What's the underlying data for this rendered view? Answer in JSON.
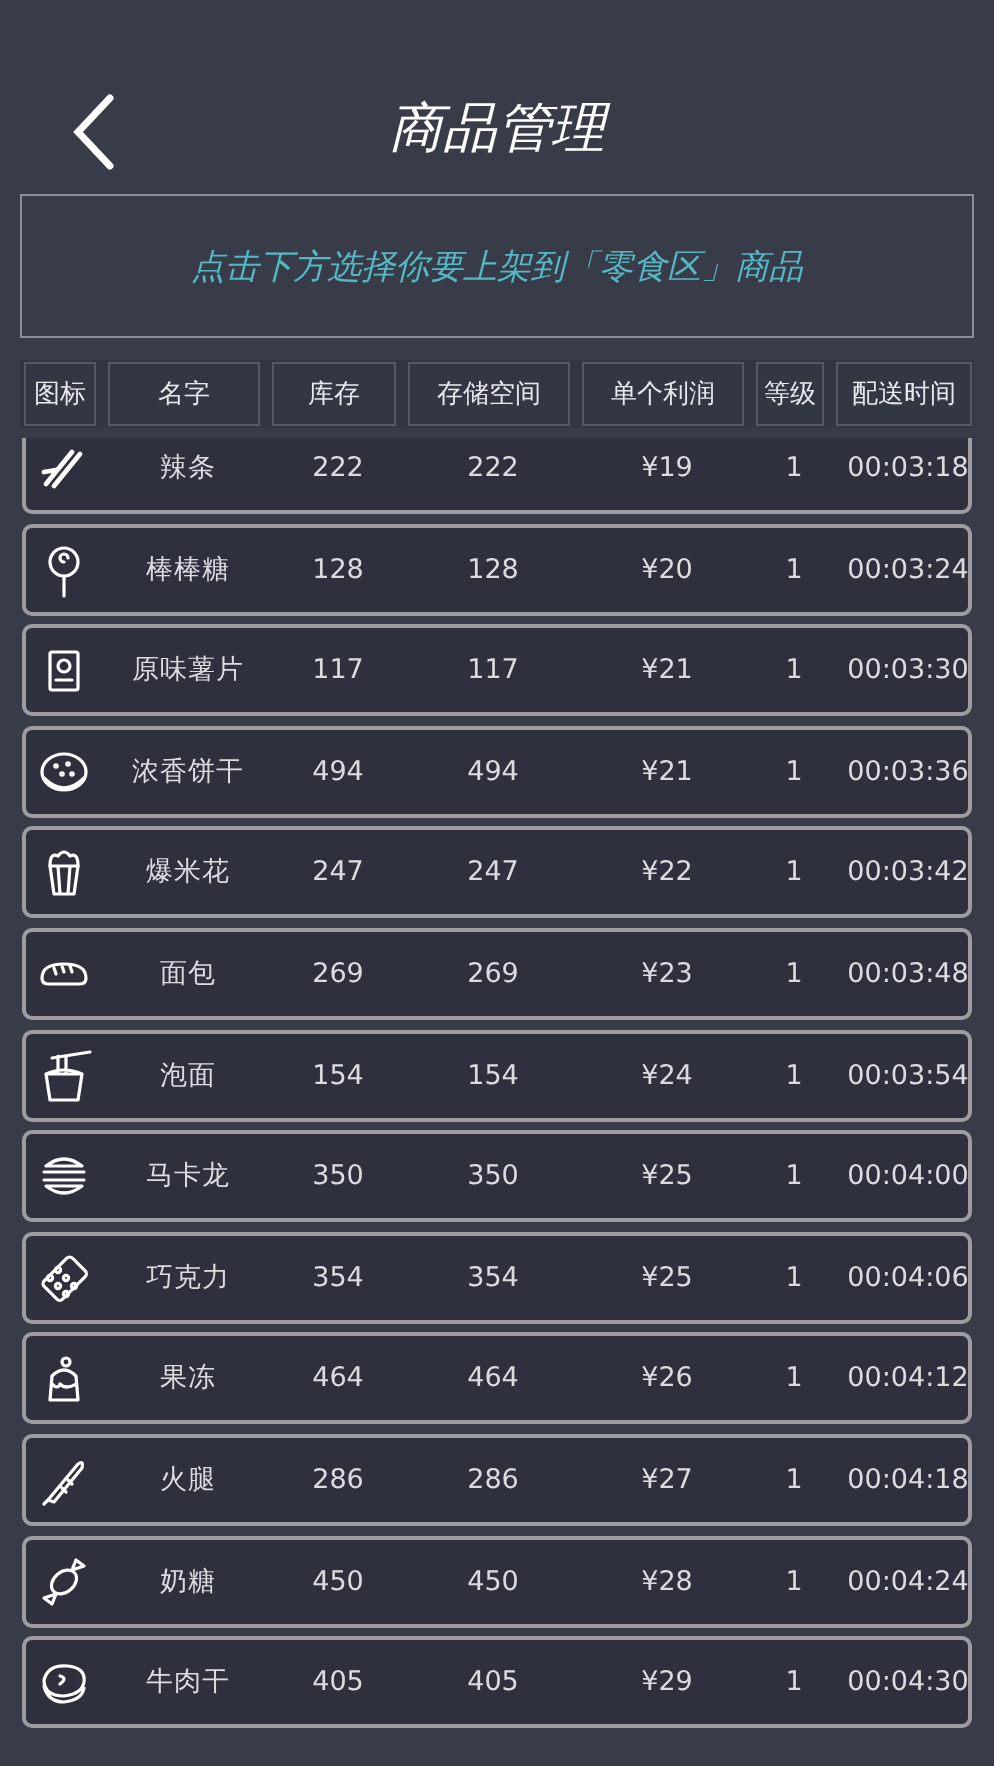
{
  "header": {
    "title": "商品管理"
  },
  "banner": "点击下方选择你要上架到「零食区」商品",
  "table": {
    "columns": [
      "图标",
      "名字",
      "库存",
      "存储空间",
      "单个利润",
      "等级",
      "配送时间"
    ],
    "rows": [
      {
        "name": "辣条",
        "stock": "222",
        "storage": "222",
        "profit": "¥19",
        "level": "1",
        "time": "00:03:18"
      },
      {
        "name": "棒棒糖",
        "stock": "128",
        "storage": "128",
        "profit": "¥20",
        "level": "1",
        "time": "00:03:24"
      },
      {
        "name": "原味薯片",
        "stock": "117",
        "storage": "117",
        "profit": "¥21",
        "level": "1",
        "time": "00:03:30"
      },
      {
        "name": "浓香饼干",
        "stock": "494",
        "storage": "494",
        "profit": "¥21",
        "level": "1",
        "time": "00:03:36"
      },
      {
        "name": "爆米花",
        "stock": "247",
        "storage": "247",
        "profit": "¥22",
        "level": "1",
        "time": "00:03:42"
      },
      {
        "name": "面包",
        "stock": "269",
        "storage": "269",
        "profit": "¥23",
        "level": "1",
        "time": "00:03:48"
      },
      {
        "name": "泡面",
        "stock": "154",
        "storage": "154",
        "profit": "¥24",
        "level": "1",
        "time": "00:03:54"
      },
      {
        "name": "马卡龙",
        "stock": "350",
        "storage": "350",
        "profit": "¥25",
        "level": "1",
        "time": "00:04:00"
      },
      {
        "name": "巧克力",
        "stock": "354",
        "storage": "354",
        "profit": "¥25",
        "level": "1",
        "time": "00:04:06"
      },
      {
        "name": "果冻",
        "stock": "464",
        "storage": "464",
        "profit": "¥26",
        "level": "1",
        "time": "00:04:12"
      },
      {
        "name": "火腿",
        "stock": "286",
        "storage": "286",
        "profit": "¥27",
        "level": "1",
        "time": "00:04:18"
      },
      {
        "name": "奶糖",
        "stock": "450",
        "storage": "450",
        "profit": "¥28",
        "level": "1",
        "time": "00:04:24"
      },
      {
        "name": "牛肉干",
        "stock": "405",
        "storage": "405",
        "profit": "¥29",
        "level": "1",
        "time": "00:04:30"
      }
    ]
  }
}
